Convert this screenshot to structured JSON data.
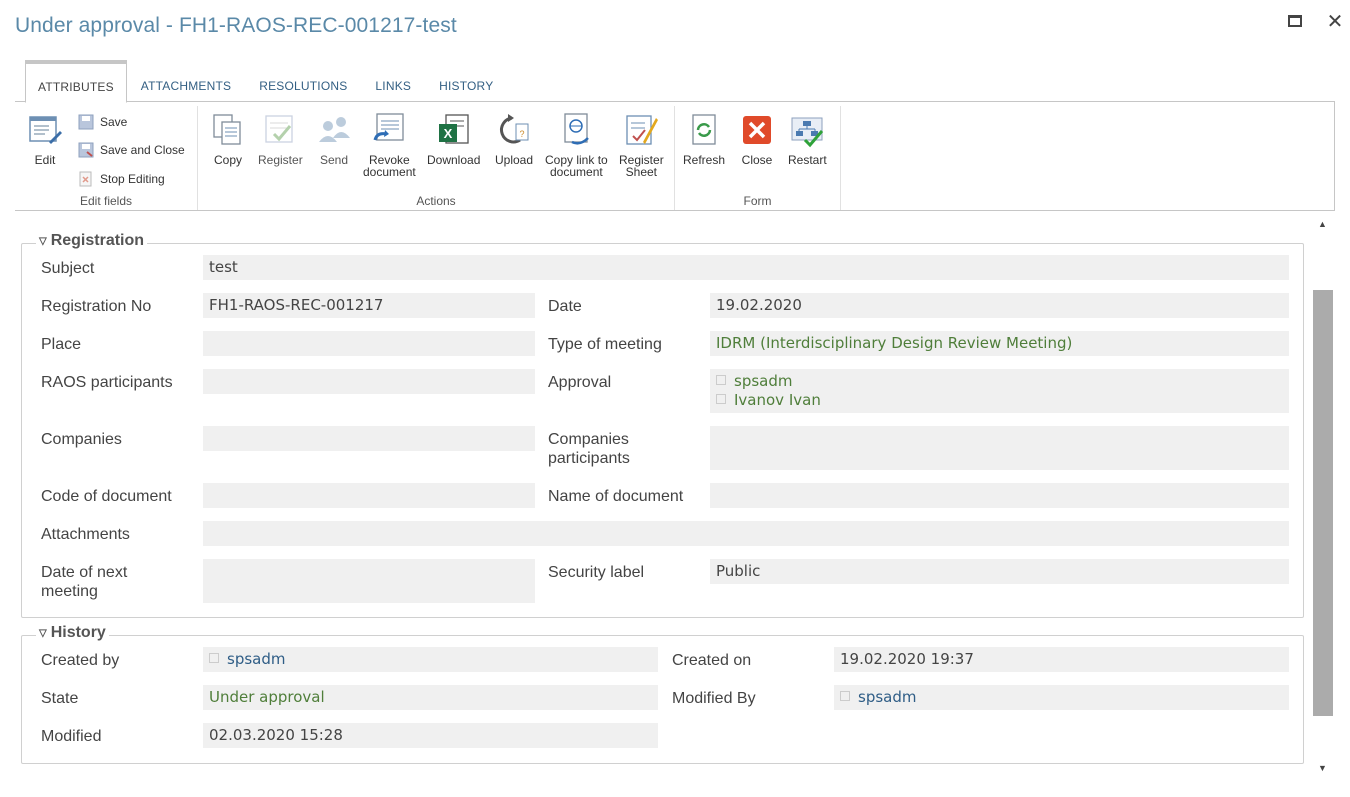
{
  "window": {
    "title": "Under approval - FH1-RAOS-REC-001217-test",
    "maximize_icon": "maximize-icon",
    "close_glyph": "✕"
  },
  "tabs": [
    {
      "label": "ATTRIBUTES",
      "active": true
    },
    {
      "label": "ATTACHMENTS"
    },
    {
      "label": "RESOLUTIONS"
    },
    {
      "label": "LINKS"
    },
    {
      "label": "HISTORY"
    }
  ],
  "ribbon": {
    "edit_fields": {
      "label": "Edit fields",
      "edit": "Edit",
      "save": "Save",
      "save_close": "Save and Close",
      "stop_editing": "Stop Editing"
    },
    "actions": {
      "label": "Actions",
      "copy": "Copy",
      "register": "Register",
      "send": "Send",
      "revoke_1": "Revoke",
      "revoke_2": "document",
      "download": "Download",
      "upload": "Upload",
      "copy_link_1": "Copy link to",
      "copy_link_2": "document",
      "register_sheet_1": "Register",
      "register_sheet_2": "Sheet"
    },
    "form": {
      "label": "Form",
      "refresh": "Refresh",
      "close": "Close",
      "restart": "Restart"
    }
  },
  "registration": {
    "legend": "Registration",
    "subject_label": "Subject",
    "subject": "test",
    "reg_no_label": "Registration No",
    "reg_no": "FH1-RAOS-REC-001217",
    "date_label": "Date",
    "date": "19.02.2020",
    "place_label": "Place",
    "place": "",
    "type_label": "Type of meeting",
    "type": "IDRM (Interdisciplinary Design Review Meeting)",
    "raos_label": "RAOS participants",
    "raos": "",
    "approval_label": "Approval",
    "approval": [
      "spsadm",
      "Ivanov Ivan"
    ],
    "companies_label": "Companies",
    "companies": "",
    "comp_part_label_1": "Companies",
    "comp_part_label_2": "participants",
    "comp_part": "",
    "code_label": "Code of document",
    "code": "",
    "name_label": "Name of document",
    "name": "",
    "attachments_label": "Attachments",
    "attachments": "",
    "next_meeting_label_1": "Date of next",
    "next_meeting_label_2": "meeting",
    "next_meeting": "",
    "security_label": "Security label",
    "security": "Public"
  },
  "history": {
    "legend": "History",
    "created_by_label": "Created by",
    "created_by": "spsadm",
    "created_on_label": "Created on",
    "created_on": "19.02.2020 19:37",
    "state_label": "State",
    "state": "Under approval",
    "modified_by_label": "Modified By",
    "modified_by": "spsadm",
    "modified_label": "Modified",
    "modified": "02.03.2020 15:28"
  },
  "colors": {
    "title": "#5a89a8",
    "link": "#2f5d86",
    "green_value": "#4f7e3a",
    "field_bg": "#f0f0f0"
  }
}
